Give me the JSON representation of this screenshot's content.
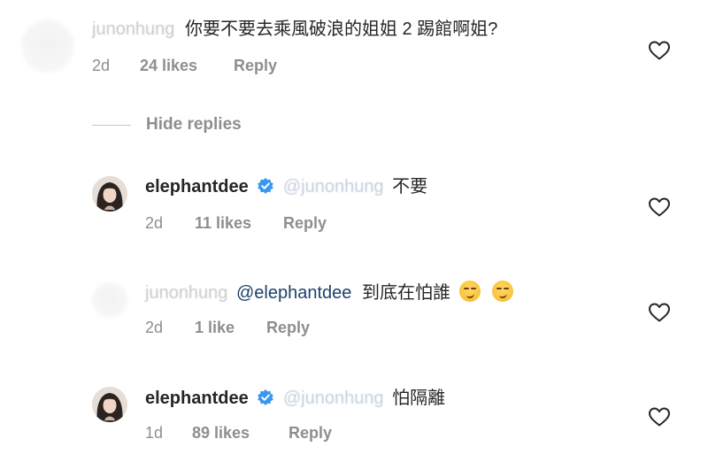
{
  "comments": [
    {
      "username": "junonhung",
      "text": "你要不要去乘風破浪的姐姐 2 踢館啊姐?",
      "mention": "",
      "time": "2d",
      "likes": "24 likes",
      "reply": "Reply"
    },
    {
      "username": "elephantdee",
      "verified": true,
      "mention": "@junonhung",
      "text": "不要",
      "time": "2d",
      "likes": "11 likes",
      "reply": "Reply"
    },
    {
      "username": "junonhung",
      "mention": "@elephantdee",
      "text": "到底在怕誰",
      "emoji": [
        "smirking-face",
        "smirking-face"
      ],
      "time": "2d",
      "likes": "1 like",
      "reply": "Reply"
    },
    {
      "username": "elephantdee",
      "verified": true,
      "mention": "@junonhung",
      "text": "怕隔離",
      "time": "1d",
      "likes": "89 likes",
      "reply": "Reply"
    }
  ],
  "hide_replies": "Hide replies",
  "icons": {
    "like": "heart-outline-icon",
    "verified": "verified-badge-icon",
    "verified_color": "#3897f0"
  }
}
